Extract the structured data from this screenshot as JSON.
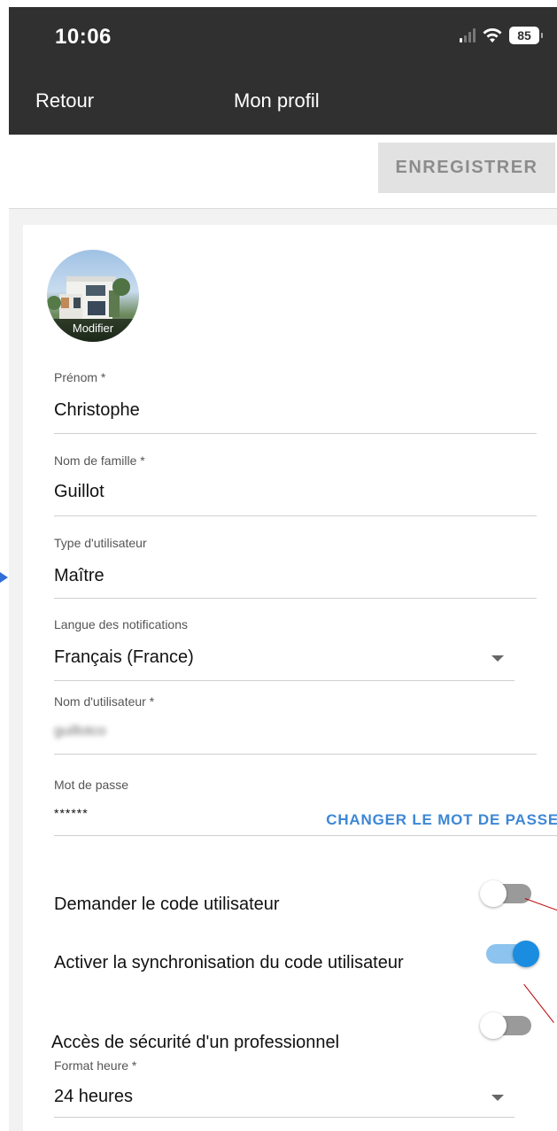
{
  "status_bar": {
    "time": "10:06",
    "battery": "85",
    "icons": [
      "cellular-signal-icon",
      "wifi-icon",
      "battery-icon"
    ]
  },
  "nav": {
    "back_label": "Retour",
    "title": "Mon profil"
  },
  "toolbar": {
    "save_label": "ENREGISTRER"
  },
  "profile": {
    "avatar_edit_label": "Modifier",
    "first_name": {
      "label": "Prénom *",
      "value": "Christophe"
    },
    "last_name": {
      "label": "Nom de famille *",
      "value": "Guillot"
    },
    "user_type": {
      "label": "Type d'utilisateur",
      "value": "Maître"
    },
    "notification_language": {
      "label": "Langue des notifications",
      "value": "Français (France)"
    },
    "username": {
      "label": "Nom d'utilisateur *",
      "value": "guillotco"
    },
    "password": {
      "label": "Mot de passe",
      "value": "******",
      "change_label": "CHANGER LE MOT DE PASSE"
    },
    "ask_user_code": {
      "label": "Demander le code utilisateur",
      "enabled": false
    },
    "sync_user_code": {
      "label": "Activer la synchronisation du code utilisateur",
      "enabled": true
    },
    "pro_security_access": {
      "label": "Accès de sécurité d'un professionnel",
      "enabled": false
    },
    "time_format": {
      "label": "Format heure *",
      "value": "24 heures"
    }
  },
  "colors": {
    "header_bg": "#303030",
    "accent_blue": "#3d87d6",
    "toggle_on": "#1b8de0",
    "annotation_red": "#b80000",
    "annotation_blue": "#2f6fd6"
  }
}
